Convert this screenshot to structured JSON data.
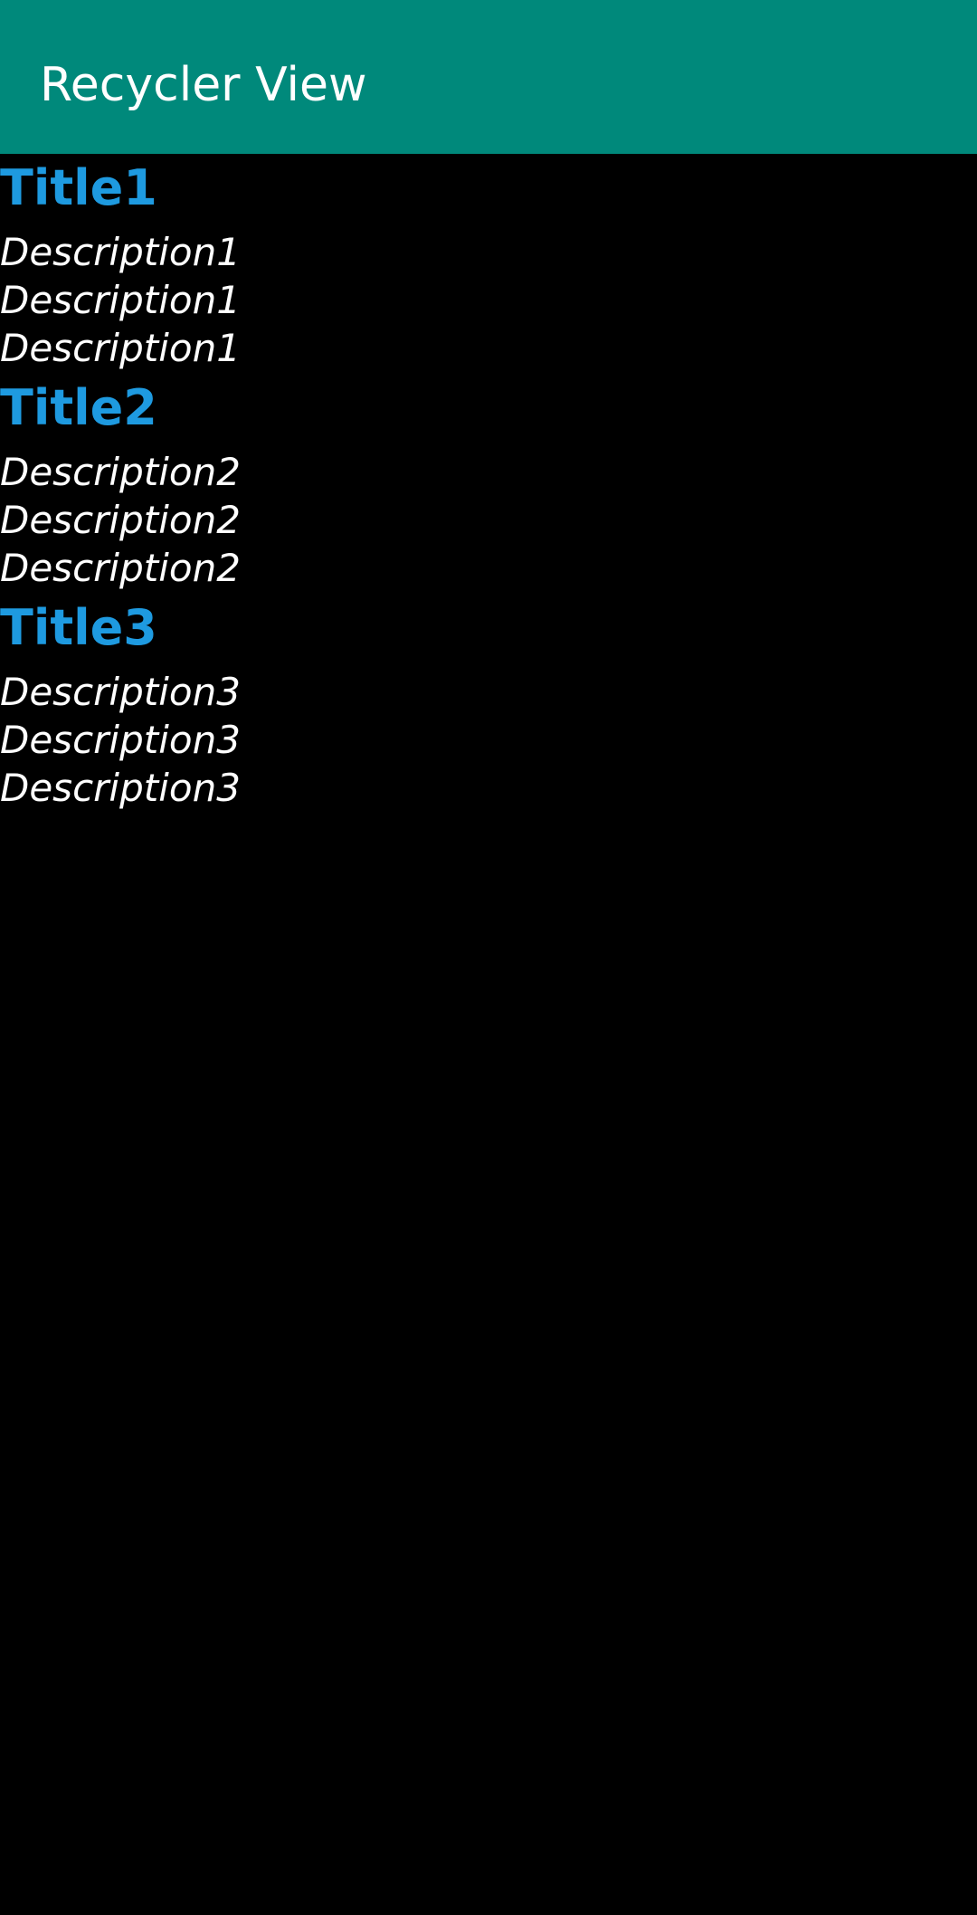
{
  "app_bar": {
    "title": "Recycler View"
  },
  "items": [
    {
      "title": "Title1",
      "descriptions": [
        "Description1",
        "Description1",
        "Description1"
      ]
    },
    {
      "title": "Title2",
      "descriptions": [
        "Description2",
        "Description2",
        "Description2"
      ]
    },
    {
      "title": "Title3",
      "descriptions": [
        "Description3",
        "Description3",
        "Description3"
      ]
    }
  ],
  "colors": {
    "app_bar": "#00897B",
    "title_text": "#1E9AE0",
    "description_text": "#FFFFFF",
    "background": "#000000"
  }
}
